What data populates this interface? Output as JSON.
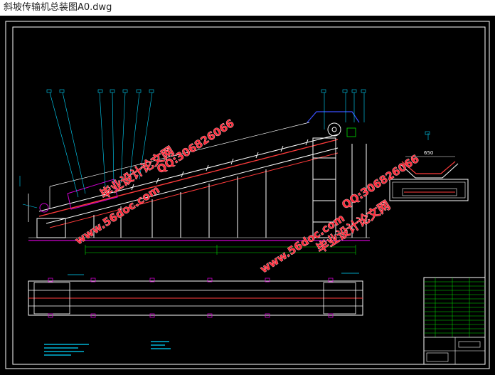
{
  "window": {
    "title": "斜坡传输机总装图A0.dwg"
  },
  "drawing": {
    "dimensions": {
      "width_label": "650"
    },
    "watermarks": [
      {
        "text": "毕业设计论文网"
      },
      {
        "text": "QQ:306826066"
      },
      {
        "text": "www.56doc.com"
      },
      {
        "text": "www.56doc.com"
      },
      {
        "text": "QQ:306826066"
      },
      {
        "text": "毕业设计论文网"
      }
    ]
  },
  "colors": {
    "background": "#000000",
    "frame": "#ffffff",
    "belt": "#ff3b3b",
    "magenta": "#d000d0",
    "green": "#00e000",
    "cyan": "#00d8ff",
    "blue": "#3a50ff",
    "yellow": "#e6e600"
  }
}
